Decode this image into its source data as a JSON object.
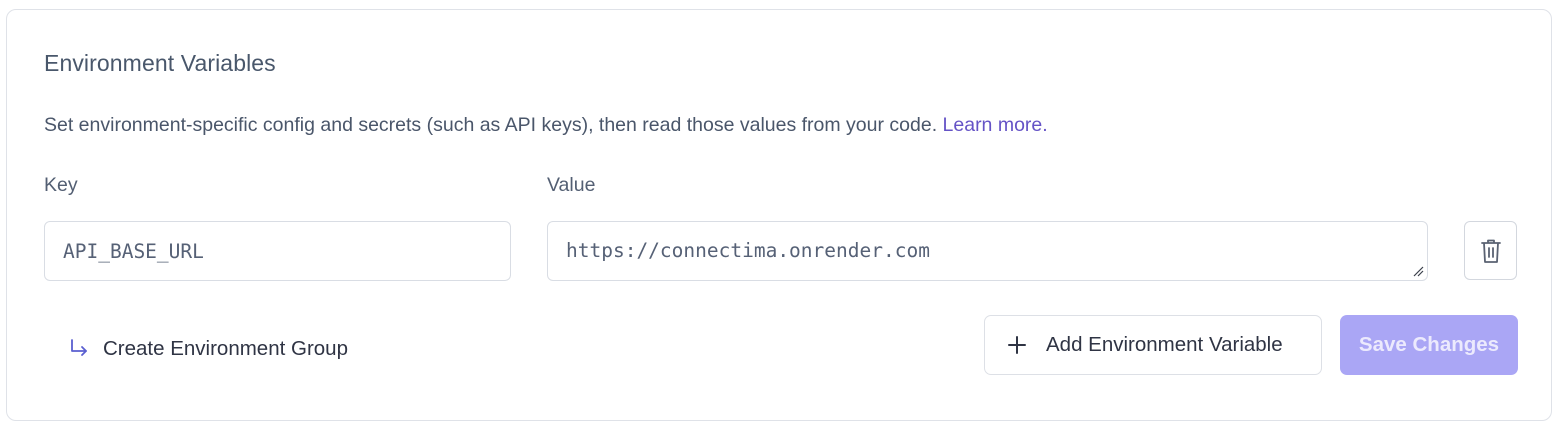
{
  "section": {
    "title": "Environment Variables",
    "description": "Set environment-specific config and secrets (such as API keys), then read those values from your code.",
    "learn_more": "Learn more."
  },
  "fields": {
    "key_label": "Key",
    "value_label": "Value",
    "key_value": "API_BASE_URL",
    "value_value": "https://connectima.onrender.com"
  },
  "actions": {
    "create_group": "Create Environment Group",
    "add_variable": "Add Environment Variable",
    "save_changes": "Save Changes"
  },
  "icons": {
    "delete": "trash-icon",
    "create_group": "arrow-down-right-icon",
    "add": "plus-icon"
  },
  "colors": {
    "link": "#6553c6",
    "save_button_bg": "#aaa6f5",
    "arrow_icon": "#5a5fd0"
  }
}
